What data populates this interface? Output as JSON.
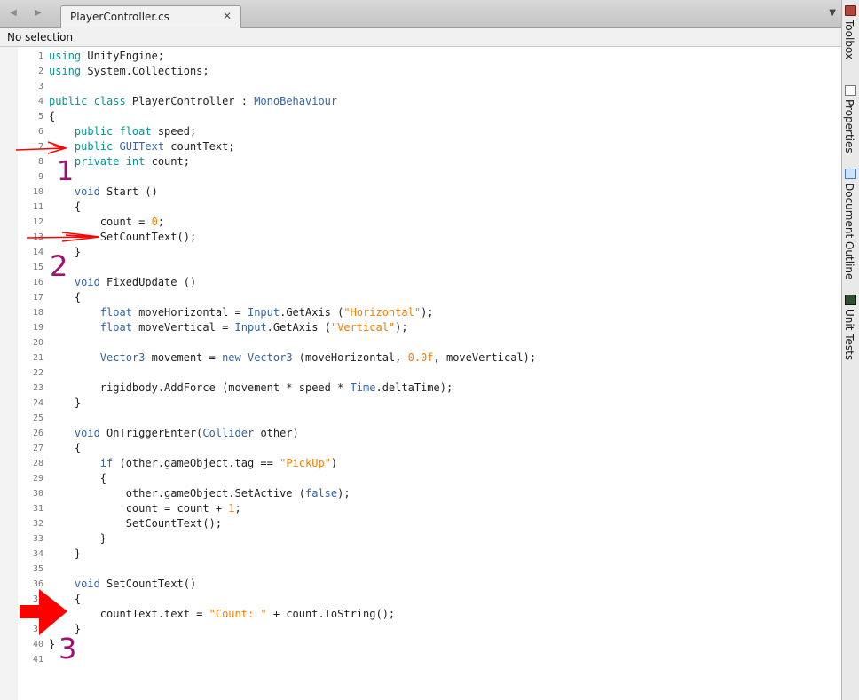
{
  "tab": {
    "title": "PlayerController.cs",
    "close_glyph": "✕"
  },
  "nav": {
    "back_glyph": "◀",
    "forward_glyph": "▶",
    "dropdown_glyph": "▼"
  },
  "selection_bar": {
    "text": "No selection"
  },
  "right_panel": {
    "tabs": [
      "Toolbox",
      "Properties",
      "Document Outline",
      "Unit Tests"
    ]
  },
  "annotations": [
    "1",
    "2",
    "3"
  ],
  "colors": {
    "keyword": "#009695",
    "type": "#3364a4",
    "string": "#f57d00",
    "annotation_arrow": "#ff0000",
    "annotation_number": "#a0106f"
  },
  "code_lines": [
    [
      [
        "kw",
        "using"
      ],
      [
        "",
        "UnityEngine;"
      ]
    ],
    [
      [
        "kw",
        "using"
      ],
      [
        "",
        "System.Collections;"
      ]
    ],
    [],
    [
      [
        "kw",
        "public class"
      ],
      [
        "",
        "PlayerController : "
      ],
      [
        "ty",
        "MonoBehaviour"
      ]
    ],
    [
      [
        "",
        "{"
      ]
    ],
    [
      [
        "",
        "    "
      ],
      [
        "kw",
        "public float"
      ],
      [
        "",
        "speed;"
      ]
    ],
    [
      [
        "",
        "    "
      ],
      [
        "kw",
        "public"
      ],
      [
        "ty",
        "GUIText"
      ],
      [
        "",
        "countText;"
      ]
    ],
    [
      [
        "",
        "    "
      ],
      [
        "kw",
        "private int"
      ],
      [
        "",
        "count;"
      ]
    ],
    [],
    [
      [
        "",
        "    "
      ],
      [
        "ty",
        "void"
      ],
      [
        "",
        "Start ()"
      ]
    ],
    [
      [
        "",
        "    {"
      ]
    ],
    [
      [
        "",
        "        count = "
      ],
      [
        "num",
        "0"
      ],
      [
        "",
        ";"
      ]
    ],
    [
      [
        "",
        "        SetCountText();"
      ]
    ],
    [
      [
        "",
        "    }"
      ]
    ],
    [],
    [
      [
        "",
        "    "
      ],
      [
        "ty",
        "void"
      ],
      [
        "",
        "FixedUpdate ()"
      ]
    ],
    [
      [
        "",
        "    {"
      ]
    ],
    [
      [
        "",
        "        "
      ],
      [
        "ty",
        "float"
      ],
      [
        "",
        "moveHorizontal = "
      ],
      [
        "ty",
        "Input"
      ],
      [
        "",
        ".GetAxis ("
      ],
      [
        "str",
        "\"Horizontal\""
      ],
      [
        "",
        ");"
      ]
    ],
    [
      [
        "",
        "        "
      ],
      [
        "ty",
        "float"
      ],
      [
        "",
        "moveVertical = "
      ],
      [
        "ty",
        "Input"
      ],
      [
        "",
        ".GetAxis ("
      ],
      [
        "str",
        "\"Vertical\""
      ],
      [
        "",
        ");"
      ]
    ],
    [],
    [
      [
        "",
        "        "
      ],
      [
        "ty",
        "Vector3"
      ],
      [
        "",
        "movement = "
      ],
      [
        "ty",
        "new Vector3"
      ],
      [
        "",
        "(moveHorizontal, "
      ],
      [
        "num",
        "0.0f"
      ],
      [
        "",
        ", moveVertical);"
      ]
    ],
    [],
    [
      [
        "",
        "        rigidbody.AddForce (movement * speed * "
      ],
      [
        "ty",
        "Time"
      ],
      [
        "",
        ".deltaTime);"
      ]
    ],
    [
      [
        "",
        "    }"
      ]
    ],
    [],
    [
      [
        "",
        "    "
      ],
      [
        "ty",
        "void"
      ],
      [
        "",
        "OnTriggerEnter("
      ],
      [
        "ty",
        "Collider"
      ],
      [
        "",
        "other)"
      ]
    ],
    [
      [
        "",
        "    {"
      ]
    ],
    [
      [
        "",
        "        "
      ],
      [
        "ty",
        "if"
      ],
      [
        "",
        "(other.gameObject.tag == "
      ],
      [
        "str",
        "\"PickUp\""
      ],
      [
        "",
        ")"
      ]
    ],
    [
      [
        "",
        "        {"
      ]
    ],
    [
      [
        "",
        "            other.gameObject.SetActive ("
      ],
      [
        "ty",
        "false"
      ],
      [
        "",
        ");"
      ]
    ],
    [
      [
        "",
        "            count = count + "
      ],
      [
        "num",
        "1"
      ],
      [
        "",
        ";"
      ]
    ],
    [
      [
        "",
        "            SetCountText();"
      ]
    ],
    [
      [
        "",
        "        }"
      ]
    ],
    [
      [
        "",
        "    }"
      ]
    ],
    [],
    [
      [
        "",
        "    "
      ],
      [
        "ty",
        "void"
      ],
      [
        "",
        "SetCountText()"
      ]
    ],
    [
      [
        "",
        "    {"
      ]
    ],
    [
      [
        "",
        "        countText.text = "
      ],
      [
        "str",
        "\"Count: \""
      ],
      [
        "",
        "+ count.ToString();"
      ]
    ],
    [
      [
        "",
        "    }"
      ]
    ],
    [
      [
        "",
        "}"
      ]
    ],
    []
  ]
}
